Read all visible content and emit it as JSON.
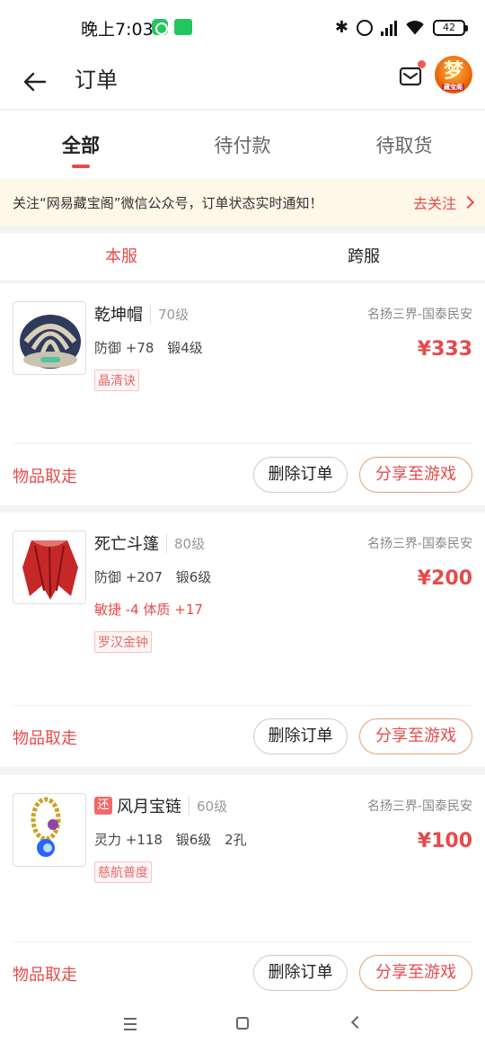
{
  "status_bar": {
    "time": "晚上7:03",
    "battery": "42"
  },
  "header": {
    "title": "订单"
  },
  "tabs": [
    {
      "label": "全部",
      "active": true
    },
    {
      "label": "待付款",
      "active": false
    },
    {
      "label": "待取货",
      "active": false
    }
  ],
  "notice": {
    "text": "关注“网易藏宝阁”微信公众号，订单状态实时通知！",
    "action": "去关注"
  },
  "sub_tabs": [
    {
      "label": "本服",
      "active": true
    },
    {
      "label": "跨服",
      "active": false
    }
  ],
  "orders": [
    {
      "name": "乾坤帽",
      "level": "70级",
      "server": "名扬三界-国泰民安",
      "price": "¥333",
      "attrs": [
        "防御 +78",
        "锻4级"
      ],
      "extra": "",
      "tag": "晶清诀",
      "status": "物品取走",
      "delete_label": "删除订单",
      "share_label": "分享至游戏"
    },
    {
      "name": "死亡斗篷",
      "level": "80级",
      "server": "名扬三界-国泰民安",
      "price": "¥200",
      "attrs": [
        "防御 +207",
        "锻6级"
      ],
      "extra": "敏捷 -4 体质 +17",
      "tag": "罗汉金钟",
      "status": "物品取走",
      "delete_label": "删除订单",
      "share_label": "分享至游戏"
    },
    {
      "badge": "还",
      "name": "风月宝链",
      "level": "60级",
      "server": "名扬三界-国泰民安",
      "price": "¥100",
      "attrs": [
        "灵力 +118",
        "锻6级",
        "2孔"
      ],
      "extra": "",
      "tag": "慈航普度",
      "status": "物品取走",
      "delete_label": "删除订单",
      "share_label": "分享至游戏"
    }
  ],
  "colors": {
    "accent": "#e54b4b",
    "notice_bg": "#fff7e8"
  },
  "icons": [
    "back-arrow-icon",
    "mail-icon",
    "avatar-icon",
    "chevron-right-icon",
    "menu-icon",
    "home-icon",
    "back-nav-icon"
  ]
}
